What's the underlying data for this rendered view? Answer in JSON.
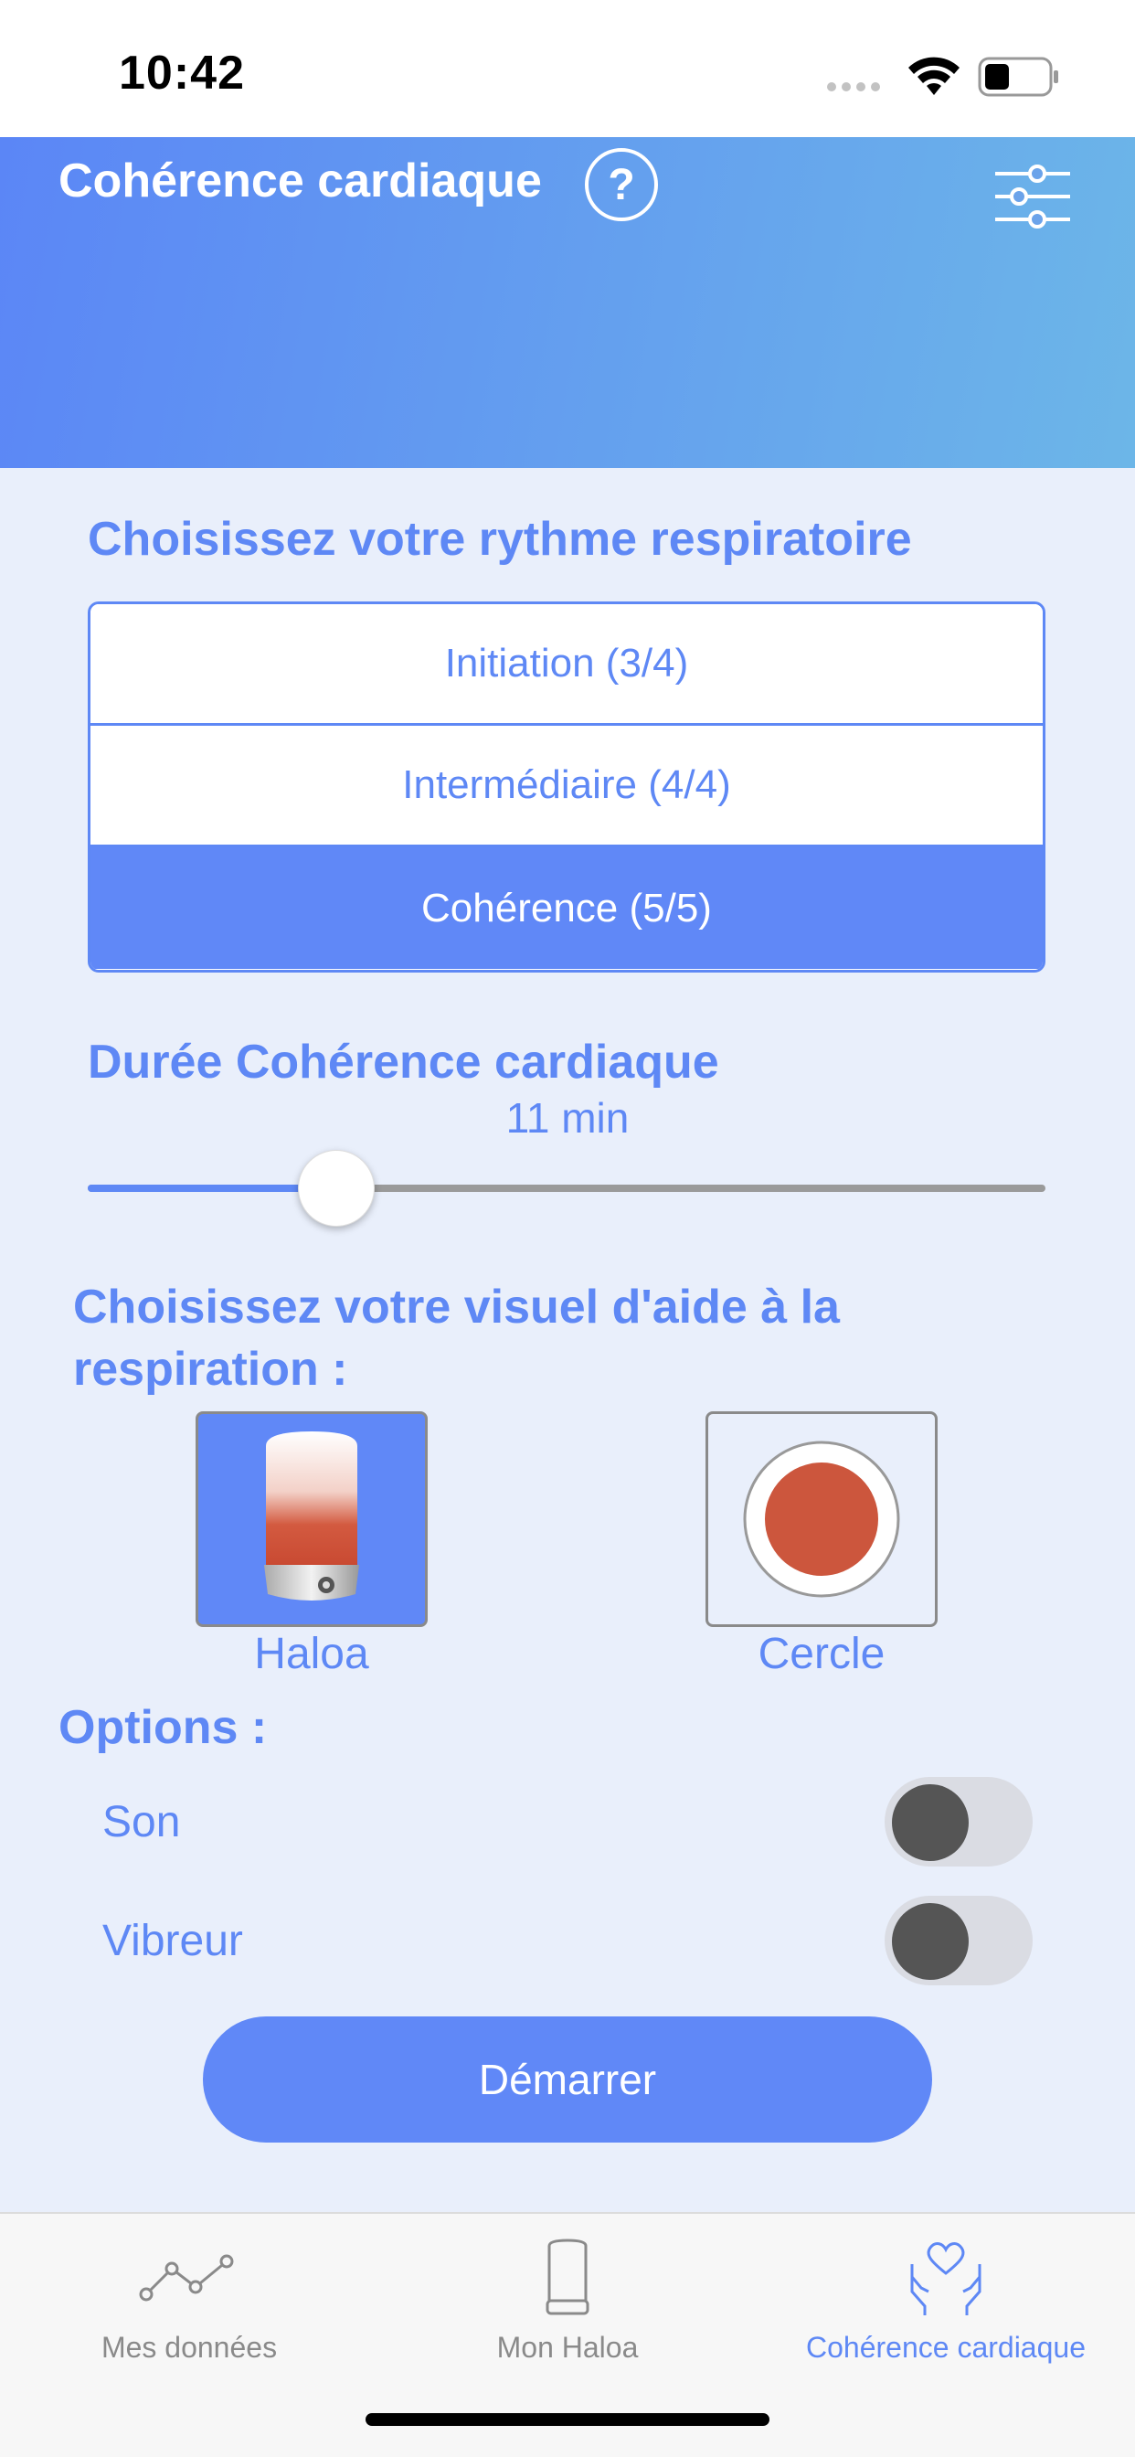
{
  "status_bar": {
    "time": "10:42"
  },
  "header": {
    "title": "Cohérence cardiaque",
    "help_label": "?"
  },
  "rhythm": {
    "title": "Choisissez votre rythme respiratoire",
    "options": [
      "Initiation (3/4)",
      "Intermédiaire (4/4)",
      "Cohérence (5/5)"
    ],
    "selected_index": 2
  },
  "duration": {
    "title": "Durée Cohérence cardiaque",
    "value_label": "11 min",
    "slider_fraction": 0.26
  },
  "visual": {
    "title_line1": "Choisissez votre visuel d'aide à la",
    "title_line2": "respiration :",
    "options": [
      "Haloa",
      "Cercle"
    ],
    "selected": "Haloa"
  },
  "options": {
    "title": "Options :",
    "sound_label": "Son",
    "sound_on": false,
    "vibration_label": "Vibreur",
    "vibration_on": false
  },
  "start_button": {
    "label": "Démarrer"
  },
  "tabs": [
    {
      "label": "Mes données",
      "icon": "line-graph-icon",
      "active": false
    },
    {
      "label": "Mon Haloa",
      "icon": "device-icon",
      "active": false
    },
    {
      "label": "Cohérence cardiaque",
      "icon": "heart-hands-icon",
      "active": true
    }
  ],
  "colors": {
    "accent": "#6088f7",
    "header_start": "#5b86f6",
    "header_end": "#6cb6e8",
    "background": "#e9effb"
  }
}
